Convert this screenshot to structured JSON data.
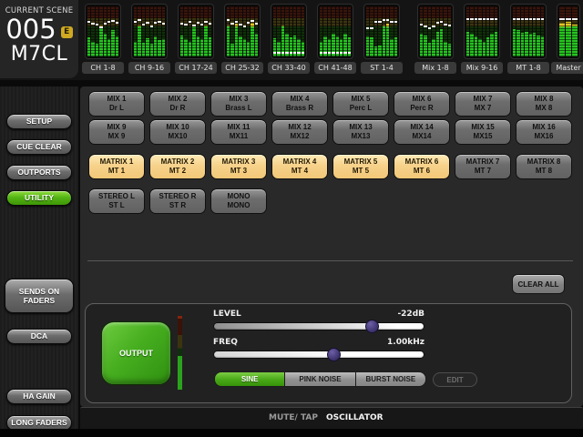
{
  "scene": {
    "label": "CURRENT SCENE",
    "number": "005",
    "edit_badge": "E",
    "name": "M7CL"
  },
  "meter_bridge": {
    "blocks": [
      {
        "label": "CH 1-8",
        "levels": [
          38,
          30,
          26,
          62,
          45,
          34,
          52,
          40
        ],
        "faders": [
          31,
          34,
          36,
          42,
          35,
          30,
          29,
          33
        ]
      },
      {
        "label": "CH 9-16",
        "levels": [
          30,
          62,
          28,
          36,
          25,
          40,
          33,
          34
        ],
        "faders": [
          30,
          28,
          36,
          32,
          40,
          33,
          31,
          35
        ]
      },
      {
        "label": "CH 17-24",
        "levels": [
          42,
          34,
          30,
          58,
          40,
          34,
          62,
          38
        ],
        "faders": [
          34,
          36,
          30,
          38,
          33,
          36,
          31,
          34
        ]
      },
      {
        "label": "CH 25-32",
        "levels": [
          62,
          25,
          66,
          40,
          34,
          30,
          68,
          45
        ],
        "faders": [
          28,
          34,
          30,
          36,
          40,
          33,
          29,
          35
        ]
      },
      {
        "label": "CH 33-40",
        "levels": [
          36,
          30,
          62,
          45,
          38,
          42,
          34,
          30
        ],
        "faders": [
          93,
          93,
          93,
          93,
          93,
          93,
          93,
          93
        ]
      },
      {
        "label": "CH 41-48",
        "levels": [
          30,
          40,
          34,
          45,
          40,
          34,
          45,
          38
        ],
        "faders": [
          93,
          93,
          93,
          93,
          93,
          93,
          93,
          93
        ]
      },
      {
        "label": "ST 1-4",
        "levels": [
          40,
          38,
          20,
          22,
          62,
          66,
          34,
          38
        ],
        "faders": [
          44,
          44,
          30,
          30,
          28,
          28,
          31,
          31
        ]
      },
      {
        "label": "Mix 1-8",
        "levels": [
          45,
          42,
          28,
          34,
          50,
          55,
          30,
          25
        ],
        "faders": [
          36,
          40,
          44,
          40,
          32,
          30,
          36,
          38
        ],
        "gap_before": true
      },
      {
        "label": "Mix 9-16",
        "levels": [
          50,
          45,
          40,
          34,
          30,
          38,
          45,
          50
        ],
        "faders": [
          26,
          26,
          26,
          26,
          26,
          26,
          26,
          26
        ]
      },
      {
        "label": "MT 1-8",
        "levels": [
          55,
          52,
          48,
          50,
          46,
          48,
          42,
          40
        ],
        "faders": [
          26,
          26,
          26,
          26,
          26,
          26,
          26,
          26
        ]
      },
      {
        "label": "Master",
        "levels": [
          68,
          70,
          64
        ],
        "faders": [
          26,
          26,
          26
        ],
        "narrow": true
      }
    ]
  },
  "sidebar": {
    "items": [
      {
        "label": "SETUP",
        "active": false
      },
      {
        "label": "CUE CLEAR",
        "active": false
      },
      {
        "label": "OUTPORTS",
        "active": false
      },
      {
        "label": "UTILITY",
        "active": true
      },
      {
        "label": "SENDS ON FADERS",
        "lines": [
          "SENDS ON",
          "FADERS"
        ],
        "active": false
      },
      {
        "label": "DCA",
        "active": false
      },
      {
        "label": "HA GAIN",
        "active": false
      },
      {
        "label": "LONG FADERS",
        "active": false
      }
    ]
  },
  "grid": {
    "rows": [
      [
        {
          "line1": "MIX 1",
          "line2": "Dr L"
        },
        {
          "line1": "MIX 2",
          "line2": "Dr R"
        },
        {
          "line1": "MIX 3",
          "line2": "Brass L"
        },
        {
          "line1": "MIX 4",
          "line2": "Brass R"
        },
        {
          "line1": "MIX 5",
          "line2": "Perc L"
        },
        {
          "line1": "MIX 6",
          "line2": "Perc R"
        },
        {
          "line1": "MIX 7",
          "line2": "MX 7"
        },
        {
          "line1": "MIX 8",
          "line2": "MX 8"
        }
      ],
      [
        {
          "line1": "MIX 9",
          "line2": "MX 9"
        },
        {
          "line1": "MIX 10",
          "line2": "MX10"
        },
        {
          "line1": "MIX 11",
          "line2": "MX11"
        },
        {
          "line1": "MIX 12",
          "line2": "MX12"
        },
        {
          "line1": "MIX 13",
          "line2": "MX13"
        },
        {
          "line1": "MIX 14",
          "line2": "MX14"
        },
        {
          "line1": "MIX 15",
          "line2": "MX15"
        },
        {
          "line1": "MIX 16",
          "line2": "MX16"
        }
      ],
      [
        {
          "line1": "MATRIX 1",
          "line2": "MT 1",
          "active": true
        },
        {
          "line1": "MATRIX 2",
          "line2": "MT 2",
          "active": true
        },
        {
          "line1": "MATRIX 3",
          "line2": "MT 3",
          "active": true
        },
        {
          "line1": "MATRIX 4",
          "line2": "MT 4",
          "active": true
        },
        {
          "line1": "MATRIX 5",
          "line2": "MT 5",
          "active": true
        },
        {
          "line1": "MATRIX 6",
          "line2": "MT 6",
          "active": true
        },
        {
          "line1": "MATRIX 7",
          "line2": "MT 7"
        },
        {
          "line1": "MATRIX 8",
          "line2": "MT 8"
        }
      ],
      [
        {
          "line1": "STEREO L",
          "line2": "ST L"
        },
        {
          "line1": "STEREO R",
          "line2": "ST R"
        },
        {
          "line1": "MONO",
          "line2": "MONO"
        }
      ]
    ]
  },
  "main": {
    "clear_all_label": "CLEAR ALL"
  },
  "oscillator": {
    "output_label": "OUTPUT",
    "level_label": "LEVEL",
    "level_value": "-22dB",
    "level_percent": 75,
    "freq_label": "FREQ",
    "freq_value": "1.00kHz",
    "freq_percent": 57,
    "wave_options": [
      {
        "label": "SINE",
        "active": true
      },
      {
        "label": "PINK NOISE",
        "active": false
      },
      {
        "label": "BURST NOISE",
        "active": false
      }
    ],
    "edit_label": "EDIT"
  },
  "bottom_tabs": [
    {
      "label": "MUTE/ TAP",
      "active": false
    },
    {
      "label": "OSCILLATOR",
      "active": true
    }
  ],
  "colors": {
    "accent_green": "#54b414",
    "matrix_orange": "#f7d28b",
    "meter_green": "#25c31f",
    "meter_yellow": "#e3c81f",
    "handle_purple": "#453a78",
    "badge_yellow": "#cfa922"
  }
}
